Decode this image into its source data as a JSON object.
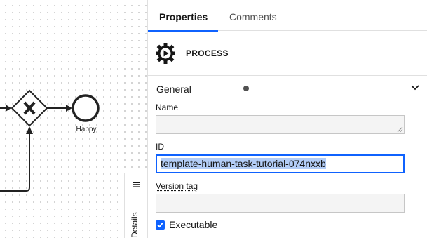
{
  "canvas": {
    "end_event_label": "Happy",
    "details_label": "Details"
  },
  "tabs": [
    {
      "label": "Properties",
      "active": true
    },
    {
      "label": "Comments",
      "active": false
    }
  ],
  "process": {
    "title": "PROCESS",
    "icon": "process-gear-play-icon"
  },
  "section": {
    "title": "General",
    "has_changes_indicator": true,
    "expanded": true
  },
  "fields": {
    "name": {
      "label": "Name",
      "value": ""
    },
    "id": {
      "label": "ID",
      "value": "template-human-task-tutorial-074nxxb"
    },
    "version_tag": {
      "label": "Version tag",
      "value": ""
    },
    "executable": {
      "label": "Executable",
      "checked": true
    }
  },
  "colors": {
    "accent": "#0f62fe",
    "selection": "#b3cdf7",
    "field_bg": "#f4f4f4"
  }
}
